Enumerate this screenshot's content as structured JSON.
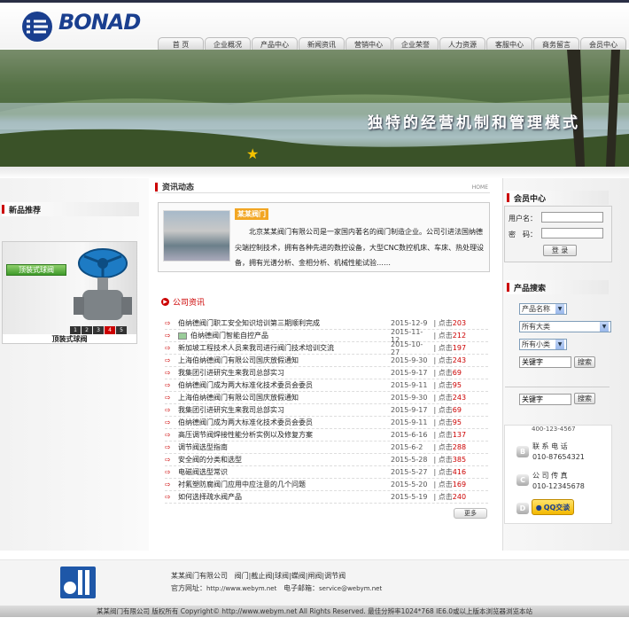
{
  "brand": {
    "logo_text": "BONAD"
  },
  "nav": [
    "首 页",
    "企业概况",
    "产品中心",
    "新闻资讯",
    "营销中心",
    "企业荣誉",
    "人力资源",
    "客服中心",
    "商务留言",
    "会员中心"
  ],
  "banner": {
    "slogan": "独特的经营机制和管理模式"
  },
  "new_products": {
    "title": "新品推荐",
    "tag": "顶装式球阀",
    "caption": "顶装式球阀",
    "pages": [
      "1",
      "2",
      "3",
      "4",
      "5"
    ],
    "active_page": "4"
  },
  "news_section": {
    "title": "资讯动态",
    "home_link": "HOME"
  },
  "about": {
    "badge": "某某阀门",
    "text": "北京某某阀门有限公司是一家国内著名的阀门制造企业。公司引进法国纳德尖端控制技术，拥有各种先进的数控设备，大型CNC数控机床、车床、热处理设备，拥有光谱分析、金相分析、机械性能试验……"
  },
  "company_news": {
    "title": "公司资讯",
    "click_label": "点击",
    "more_label": "更多",
    "items": [
      {
        "title": "伯纳德阀门职工安全知识培训第三期顺利完成",
        "date": "2015-12-9",
        "count": "203",
        "has_img": false
      },
      {
        "title": "伯纳德阀门智能自控产品",
        "date": "2015-11-12",
        "count": "212",
        "has_img": true
      },
      {
        "title": "新加坡工程技术人员来我司进行阀门技术培训交流",
        "date": "2015-10-27",
        "count": "197",
        "has_img": false
      },
      {
        "title": "上海伯纳德阀门有限公司国庆放假通知",
        "date": "2015-9-30",
        "count": "243",
        "has_img": false
      },
      {
        "title": "我集团引进研究生来我司总部实习",
        "date": "2015-9-17",
        "count": "69",
        "has_img": false
      },
      {
        "title": "伯纳德阀门成为两大标准化技术委员会委员",
        "date": "2015-9-11",
        "count": "95",
        "has_img": false
      },
      {
        "title": "上海伯纳德阀门有限公司国庆放假通知",
        "date": "2015-9-30",
        "count": "243",
        "has_img": false
      },
      {
        "title": "我集团引进研究生来我司总部实习",
        "date": "2015-9-17",
        "count": "69",
        "has_img": false
      },
      {
        "title": "伯纳德阀门成为两大标准化技术委员会委员",
        "date": "2015-9-11",
        "count": "95",
        "has_img": false
      },
      {
        "title": "高压调节阀焊接性能分析实例以及修复方案",
        "date": "2015-6-16",
        "count": "137",
        "has_img": false
      },
      {
        "title": "调节阀选型指南",
        "date": "2015-6-2",
        "count": "288",
        "has_img": false
      },
      {
        "title": "安全阀的分类和选型",
        "date": "2015-5-28",
        "count": "385",
        "has_img": false
      },
      {
        "title": "电磁阀选型常识",
        "date": "2015-5-27",
        "count": "416",
        "has_img": false
      },
      {
        "title": "衬氟塑防腐阀门应用中应注意的几个问题",
        "date": "2015-5-20",
        "count": "169",
        "has_img": false
      },
      {
        "title": "如何选择疏水阀产品",
        "date": "2015-5-19",
        "count": "240",
        "has_img": false
      }
    ]
  },
  "member": {
    "title": "会员中心",
    "username_label": "用户名：",
    "password_label": "密　码：",
    "login_button": "登 录"
  },
  "product_search": {
    "title": "产品搜索",
    "field_select": "产品名称",
    "category_select": "所有大类",
    "subcategory_select": "所有小类",
    "keyword_placeholder": "关键字",
    "search_button": "搜索",
    "keyword2_placeholder": "关键字",
    "search_button2": "搜索"
  },
  "contact": {
    "phone_partial": "400-123-4567",
    "tel_label": "联 系 电 话",
    "tel": "010-87654321",
    "fax_label": "公 司 传 真",
    "fax": "010-12345678",
    "qq_label": "QQ交谈",
    "icon_b": "B",
    "icon_c": "C",
    "icon_d": "D"
  },
  "footer": {
    "company": "某某阀门有限公司",
    "products": "阀门|截止阀|球阀|蝶阀|闸阀|调节阀",
    "site_label": "官方网址：",
    "site": "http://www.webym.net",
    "email_label": "电子邮箱：",
    "email": "service@webym.net"
  },
  "copyright": "某某阀门有限公司 版权所有 Copyright© http://www.webym.net All Rights Reserved. 最佳分辨率1024*768 IE6.0或以上版本浏览器浏览本站"
}
